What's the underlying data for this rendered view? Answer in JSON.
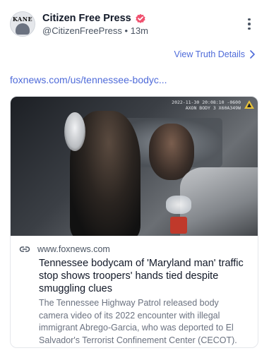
{
  "post": {
    "author_name": "Citizen Free Press",
    "avatar_text": "KANE",
    "handle": "@CitizenFreePress",
    "separator": "•",
    "time": "13m",
    "view_details_label": "View Truth Details",
    "link_text": "foxnews.com/us/tennessee-bodyc..."
  },
  "card": {
    "bodycam_line1": "2022-11-30 20:08:10 -0600",
    "bodycam_line2": "AXON BODY 3 X60A349W",
    "domain": "www.foxnews.com",
    "headline": "Tennessee bodycam of 'Maryland man' traffic stop shows troopers' hands tied despite smuggling clues",
    "description": "The Tennessee Highway Patrol released body camera video of its 2022 encounter with illegal immigrant Abrego-Garcia, who was deported to El Salvador's Terrorist Confinement Center (CECOT)."
  },
  "colors": {
    "accent": "#4f6bd9",
    "verified_badge": "#f0506e"
  },
  "icons": [
    "verified-icon",
    "more-icon",
    "chevron-right-icon",
    "link-icon",
    "axon-icon"
  ]
}
